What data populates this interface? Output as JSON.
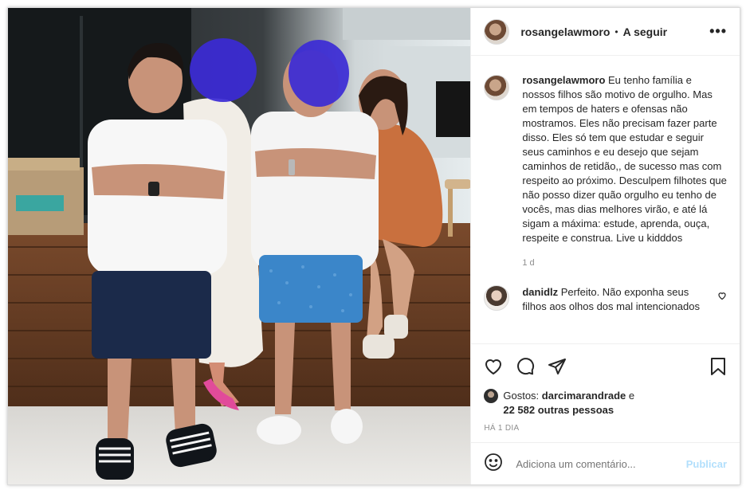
{
  "post": {
    "username": "rosangelawmoro",
    "separator": "•",
    "follow_label": "A seguir",
    "more_label": "•••",
    "caption": "Eu tenho família e nossos filhos são motivo de orgulho. Mas em tempos de haters e ofensas não mostramos. Eles não precisam fazer parte disso. Eles só tem que estudar e seguir seus caminhos e eu desejo que sejam caminhos de retidão,, de sucesso mas com respeito ao próximo. Desculpem filhotes que não posso dizer quão orgulho eu tenho de vocês, mas dias melhores virão, e até lá sigam a máxima: estude, aprenda, ouça, respeite e construa. Live u kidddos",
    "caption_age": "1 d"
  },
  "comments": [
    {
      "username": "danidlz",
      "text": "Perfeito. Não exponha seus filhos aos olhos dos mal intencionados"
    }
  ],
  "likes": {
    "prefix": "Gostos:",
    "user": "darcimarandrade",
    "conj": "e",
    "others": "22 582 outras pessoas"
  },
  "posted_ago": "HÁ 1 DIA",
  "add_comment": {
    "placeholder": "Adiciona um comentário...",
    "publish_label": "Publicar"
  },
  "icons": {
    "like": "heart-icon",
    "comment": "comment-icon",
    "share": "share-icon",
    "save": "bookmark-icon",
    "emoji": "emoji-icon",
    "comment_like": "heart-icon"
  },
  "colors": {
    "publish_disabled": "#b2dffc",
    "muted_text": "#8e8e8e",
    "border": "#efefef"
  }
}
